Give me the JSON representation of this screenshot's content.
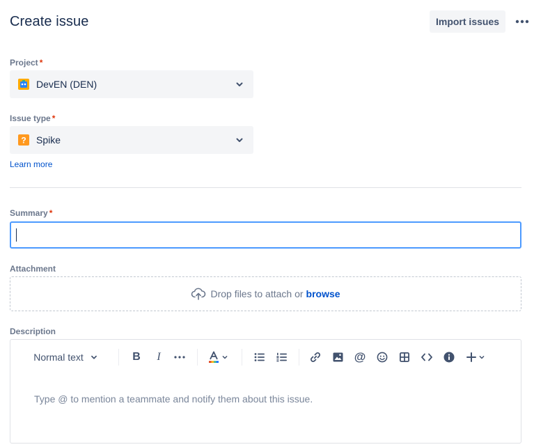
{
  "header": {
    "title": "Create issue",
    "import_label": "Import issues"
  },
  "project": {
    "label": "Project",
    "required_mark": "*",
    "value": "DevEN (DEN)"
  },
  "issue_type": {
    "label": "Issue type",
    "required_mark": "*",
    "value": "Spike",
    "learn_more": "Learn more"
  },
  "summary": {
    "label": "Summary",
    "required_mark": "*",
    "value": ""
  },
  "attachment": {
    "label": "Attachment",
    "drop_text": "Drop files to attach or",
    "browse_label": "browse"
  },
  "description": {
    "label": "Description",
    "text_style": "Normal text",
    "placeholder": "Type @ to mention a teammate and notify them about this issue."
  },
  "colors": {
    "accent": "#0052CC",
    "focus_border": "#4C9AFF",
    "required": "#DE350B",
    "spike_icon": "#FF991F",
    "project_icon": "#FFAB00"
  },
  "toolbar_icons": [
    "bold-icon",
    "italic-icon",
    "more-formatting-icon",
    "text-color-icon",
    "bullet-list-icon",
    "numbered-list-icon",
    "link-icon",
    "image-icon",
    "mention-icon",
    "emoji-icon",
    "table-icon",
    "code-icon",
    "info-icon",
    "insert-icon"
  ]
}
